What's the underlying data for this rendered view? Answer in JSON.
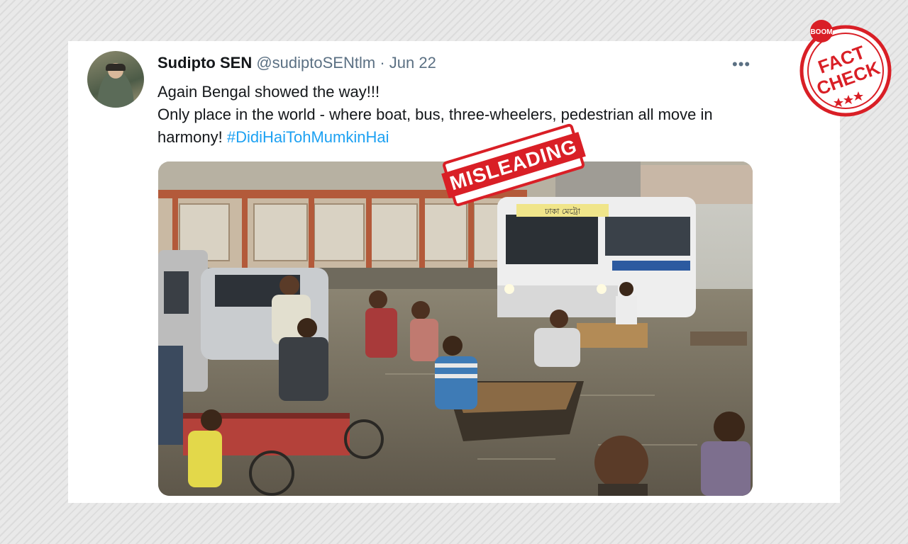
{
  "tweet": {
    "name": "Sudipto SEN",
    "handle": "@sudiptoSENtlm",
    "separator": "·",
    "date": "Jun 22",
    "more_label": "•••",
    "line1": "Again Bengal showed the way!!!",
    "line2_text": "Only place in the world - where boat, bus, three-wheelers, pedestrian all move in harmony!",
    "hashtag": "#DidiHaiTohMumkinHai"
  },
  "overlay": {
    "misleading_label": "MISLEADING",
    "factcheck_brand": "BOOM",
    "factcheck_line1": "FACT",
    "factcheck_line2": "CHECK",
    "stamp_color": "#d91f26"
  },
  "media": {
    "bus_sign": "ঢাকা মেট্রো"
  }
}
